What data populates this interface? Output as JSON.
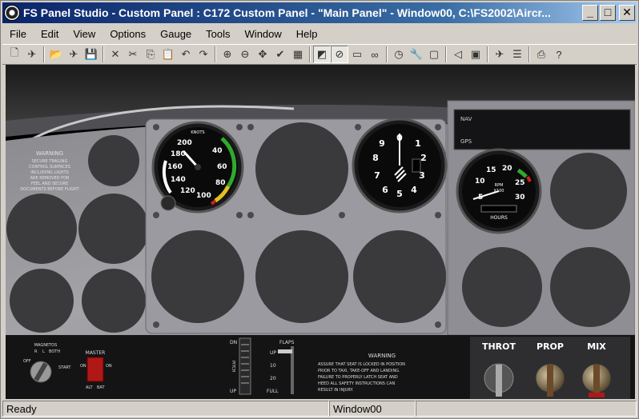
{
  "window": {
    "title": "FS Panel Studio - Custom Panel : C172 Custom Panel - \"Main Panel\" - Window00, C:\\FS2002\\Aircr...",
    "minimize_label": "_",
    "maximize_label": "□",
    "close_label": "✕"
  },
  "menu": [
    "File",
    "Edit",
    "View",
    "Options",
    "Gauge",
    "Tools",
    "Window",
    "Help"
  ],
  "toolbar": [
    {
      "name": "new-icon",
      "glyph": "🗋"
    },
    {
      "name": "aircraft-icon",
      "glyph": "✈"
    },
    {
      "sep": true
    },
    {
      "name": "open-icon",
      "glyph": "📂"
    },
    {
      "name": "open-aircraft-icon",
      "glyph": "✈"
    },
    {
      "name": "save-icon",
      "glyph": "💾"
    },
    {
      "sep": true
    },
    {
      "name": "delete-icon",
      "glyph": "✕"
    },
    {
      "name": "cut-icon",
      "glyph": "✂"
    },
    {
      "name": "copy-icon",
      "glyph": "⎘"
    },
    {
      "name": "paste-icon",
      "glyph": "📋"
    },
    {
      "name": "undo-icon",
      "glyph": "↶"
    },
    {
      "name": "redo-icon",
      "glyph": "↷"
    },
    {
      "sep": true
    },
    {
      "name": "zoom-in-icon",
      "glyph": "⊕"
    },
    {
      "name": "zoom-out-icon",
      "glyph": "⊖"
    },
    {
      "name": "fit-icon",
      "glyph": "✥"
    },
    {
      "name": "check-icon",
      "glyph": "✔"
    },
    {
      "name": "grid-icon",
      "glyph": "▦"
    },
    {
      "sep": true
    },
    {
      "name": "background-icon",
      "glyph": "◩",
      "active": true
    },
    {
      "name": "no-background-icon",
      "glyph": "⊘",
      "active": true
    },
    {
      "name": "rectangle-icon",
      "glyph": "▭"
    },
    {
      "name": "binoculars-icon",
      "glyph": "∞"
    },
    {
      "sep": true
    },
    {
      "name": "gauge-icon",
      "glyph": "◷"
    },
    {
      "name": "wrench-icon",
      "glyph": "🔧"
    },
    {
      "name": "window-icon",
      "glyph": "▢"
    },
    {
      "sep": true
    },
    {
      "name": "speaker-icon",
      "glyph": "◁"
    },
    {
      "name": "image-icon",
      "glyph": "▣"
    },
    {
      "sep": true
    },
    {
      "name": "plane-icon",
      "glyph": "✈"
    },
    {
      "name": "list-icon",
      "glyph": "☰"
    },
    {
      "sep": true
    },
    {
      "name": "print-icon",
      "glyph": "⎙"
    },
    {
      "name": "help-icon",
      "glyph": "?"
    }
  ],
  "panel": {
    "warning_left": [
      "WARNING",
      "SECURE TRAILING",
      "CONTROL SURFACES",
      "INCLUDING LIGHTS",
      "ARE REMOVED FOR",
      "FEEL AND SECURE",
      "DOCUMENTS BEFORE FLIGHT"
    ],
    "airspeed": {
      "label_top": "KNOTS",
      "scale": [
        "40",
        "60",
        "80",
        "100",
        "120",
        "140",
        "160",
        "180",
        "200"
      ]
    },
    "altimeter": {
      "digits": [
        "0",
        "1",
        "2",
        "3",
        "4",
        "5",
        "6",
        "7",
        "8",
        "9"
      ]
    },
    "tach": {
      "scale": [
        "5",
        "10",
        "15",
        "20",
        "25",
        "30"
      ],
      "rpm": "RPM",
      "x100": "X100",
      "hours": "HOURS"
    },
    "nav_label": "NAV",
    "gps_label": "GPS",
    "magnetos": {
      "title": "MAGNETOS",
      "off": "OFF",
      "r": "R",
      "l": "L",
      "both": "BOTH",
      "start": "START"
    },
    "master": {
      "title": "MASTER",
      "on_left": "ON",
      "on_right": "ON",
      "alt": "ALT",
      "bat": "BAT"
    },
    "pitch": {
      "dn": "DN",
      "up": "UP",
      "label": "PITCH"
    },
    "flaps": {
      "title": "FLAPS",
      "up": "UP",
      "ten": "10",
      "twenty": "20",
      "full": "FULL"
    },
    "warning_bottom": {
      "title": "WARNING",
      "lines": [
        "ASSURE THAT SEAT IS LOCKED IN POSITION",
        "PRIOR TO TAXI, TAKE-OFF AND LANDING.",
        "FAILURE TO PROPERLY LATCH SEAT AND",
        "HEED ALL SAFETY INSTRUCTIONS CAN",
        "RESULT IN INJURY."
      ]
    },
    "levers": {
      "throttle": "THROT",
      "prop": "PROP",
      "mix": "MIX"
    }
  },
  "status": {
    "left": "Ready",
    "window": "Window00",
    "extra": ""
  }
}
